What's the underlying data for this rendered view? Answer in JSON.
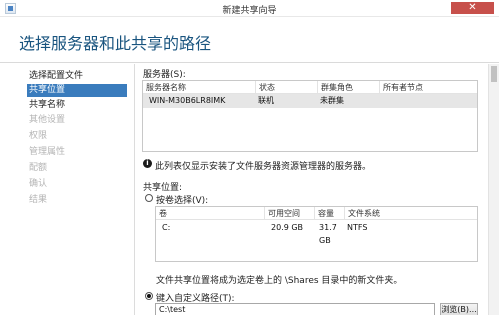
{
  "window": {
    "title": "新建共享向导",
    "close_glyph": "✕"
  },
  "header": {
    "title": "选择服务器和此共享的路径"
  },
  "sidebar": {
    "items": [
      {
        "label": "选择配置文件",
        "state": "normal"
      },
      {
        "label": "共享位置",
        "state": "active"
      },
      {
        "label": "共享名称",
        "state": "normal"
      },
      {
        "label": "其他设置",
        "state": "disabled"
      },
      {
        "label": "权限",
        "state": "disabled"
      },
      {
        "label": "管理属性",
        "state": "disabled"
      },
      {
        "label": "配额",
        "state": "disabled"
      },
      {
        "label": "确认",
        "state": "disabled"
      },
      {
        "label": "结果",
        "state": "disabled"
      }
    ]
  },
  "servers": {
    "label": "服务器(S):",
    "columns": [
      "服务器名称",
      "状态",
      "群集角色",
      "所有者节点"
    ],
    "rows": [
      [
        "WIN-M30B6LR8IMK",
        "联机",
        "未群集",
        ""
      ]
    ],
    "note": "此列表仅显示安装了文件服务器资源管理器的服务器。"
  },
  "share_location": {
    "label": "共享位置:",
    "by_volume_label": "按卷选择(V):",
    "volume_columns": [
      "卷",
      "可用空间",
      "容量",
      "文件系统"
    ],
    "volume_rows": [
      [
        "C:",
        "20.9 GB",
        "31.7 GB",
        "NTFS"
      ]
    ],
    "volume_note": "文件共享位置将成为选定卷上的 \\Shares 目录中的新文件夹。",
    "custom_path_label": "键入自定义路径(T):",
    "custom_path_value": "C:\\test",
    "browse_label": "浏览(B)..."
  },
  "colors": {
    "accent": "#3a7cbd",
    "title": "#19547f",
    "close_button": "#c7504b"
  }
}
